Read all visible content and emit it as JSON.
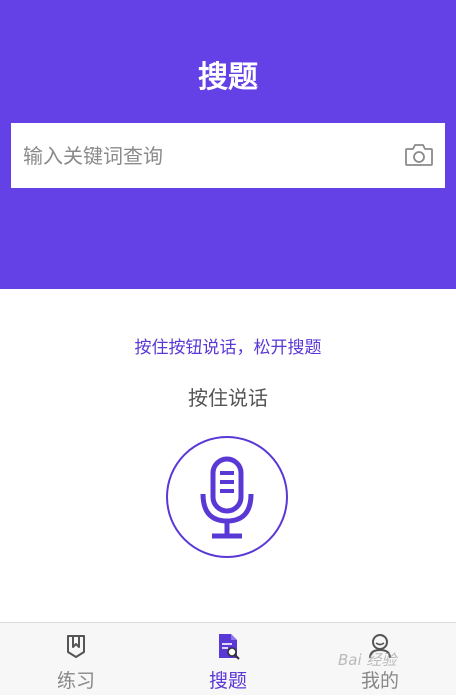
{
  "header": {
    "title": "搜题",
    "background_color": "#6441e6"
  },
  "search": {
    "placeholder": "输入关键词查询",
    "value": "",
    "camera_icon": "camera-icon"
  },
  "voice": {
    "hint": "按住按钮说话，松开搜题",
    "label": "按住说话",
    "mic_icon": "microphone-icon",
    "accent_color": "#5a38d6"
  },
  "tabbar": {
    "tabs": [
      {
        "label": "练习",
        "icon": "bookmark-book-icon",
        "active": false
      },
      {
        "label": "搜题",
        "icon": "document-search-icon",
        "active": true
      },
      {
        "label": "我的",
        "icon": "user-icon",
        "active": false
      }
    ]
  },
  "watermark": "Bai 经验"
}
